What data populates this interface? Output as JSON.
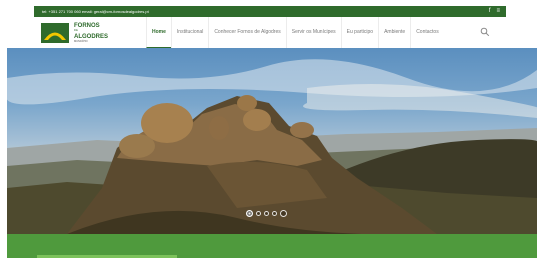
{
  "topbar": {
    "contact": "tel: +351 271 700 060 email: geral@cm-fornosdealgodres.pt",
    "icons": [
      "facebook-icon",
      "rss-icon"
    ],
    "facebook_glyph": "f",
    "rss_glyph": "≡"
  },
  "logo": {
    "line1": "FORNOS",
    "line2": "DE",
    "line3": "ALGODRES",
    "line4": "MUNICÍPIO"
  },
  "nav": {
    "items": [
      "Home",
      "Institucional",
      "Conhecer Fornos de Algodres",
      "Servir os Munícipes",
      "Eu participo",
      "Ambiente",
      "Contactos"
    ],
    "active_index": 0
  },
  "slider": {
    "slide_count": 5,
    "active_slide": 1
  },
  "colors": {
    "brand_green": "#2f6b2c",
    "bottom_bar": "#4f9a3d"
  }
}
